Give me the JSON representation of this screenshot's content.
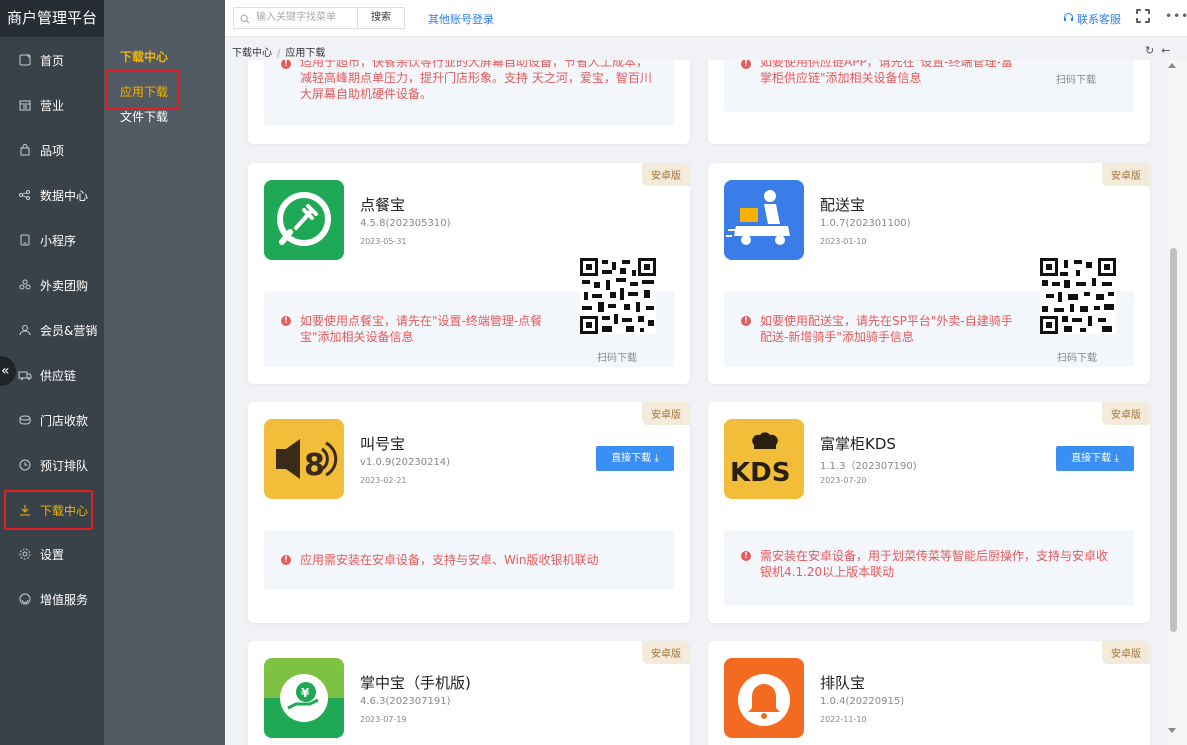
{
  "app_title": "商户管理平台",
  "nav": [
    {
      "label": "首页",
      "icon": "home-icon"
    },
    {
      "label": "营业",
      "icon": "calendar-icon"
    },
    {
      "label": "品项",
      "icon": "bag-icon"
    },
    {
      "label": "数据中心",
      "icon": "share-icon"
    },
    {
      "label": "小程序",
      "icon": "mobile-icon"
    },
    {
      "label": "外卖团购",
      "icon": "group-icon"
    },
    {
      "label": "会员&营销",
      "icon": "user-icon"
    },
    {
      "label": "供应链",
      "icon": "truck-icon"
    },
    {
      "label": "门店收款",
      "icon": "wallet-icon"
    },
    {
      "label": "预订排队",
      "icon": "clock-icon"
    },
    {
      "label": "下载中心",
      "icon": "download-icon"
    },
    {
      "label": "设置",
      "icon": "gear-icon"
    },
    {
      "label": "增值服务",
      "icon": "service-icon"
    }
  ],
  "subnav": {
    "heading": "下载中心",
    "items": [
      "应用下载",
      "文件下载"
    ]
  },
  "topbar": {
    "search_placeholder": "输入关键字找菜单",
    "search_button": "搜索",
    "other_login": "其他账号登录",
    "contact": "联系客服",
    "more": "•••"
  },
  "breadcrumb": [
    "下载中心",
    "应用下载"
  ],
  "cards": {
    "top_left_notice": "适用于超市，快餐余饮等行业的大屏幕自助设备，节省人工成本，减轻高峰期点单压力，提升门店形象。支持 天之河，爱宝，智百川大屏幕自助机硬件设备。",
    "top_right_notice": "如要使用供应链APP，请先在\"设置-终端管理-富掌柜供应链\"添加相关设备信息",
    "scan_label": "扫码下载",
    "download_label": "直接下载",
    "tag": "安卓版",
    "apps": [
      {
        "name": "点餐宝",
        "version": "4.5.8(202305310)",
        "date": "2023-05-31",
        "notice": "如要使用点餐宝，请先在\"设置-终端管理-点餐宝\"添加相关设备信息"
      },
      {
        "name": "配送宝",
        "version": "1.0.7(202301100)",
        "date": "2023-01-10",
        "notice": "如要使用配送宝，请先在SP平台\"外卖-自建骑手配送-新增骑手\"添加骑手信息"
      },
      {
        "name": "叫号宝",
        "version": "v1.0.9(20230214)",
        "date": "2023-02-21",
        "notice": "应用需安装在安卓设备，支持与安卓、Win版收银机联动"
      },
      {
        "name": "富掌柜KDS",
        "version": "1.1.3（202307190)",
        "date": "2023-07-20",
        "notice": "需安装在安卓设备，用于划菜传菜等智能后厨操作，支持与安卓收银机4.1.20以上版本联动"
      },
      {
        "name": "掌中宝（手机版)",
        "version": "4.6.3(202307191)",
        "date": "2023-07-19"
      },
      {
        "name": "排队宝",
        "version": "1.0.4(20220915)",
        "date": "2022-11-10"
      }
    ]
  },
  "colors": {
    "accent": "#f5b300",
    "link": "#2d7ff9",
    "alert": "#e35b5b",
    "highlight_box": "#e02020"
  }
}
